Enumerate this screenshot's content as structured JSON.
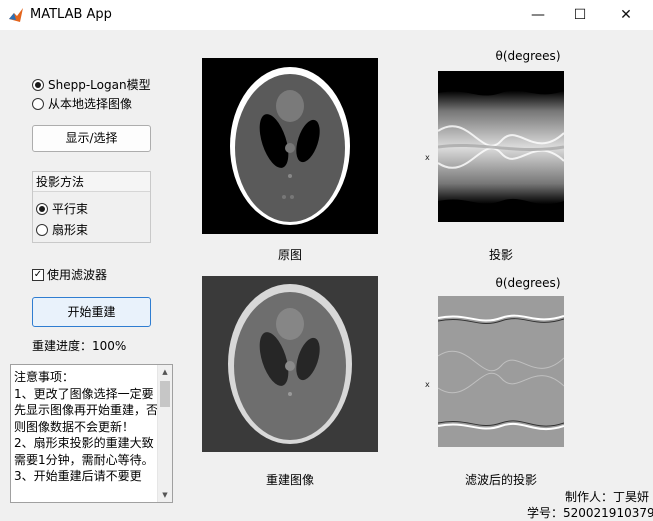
{
  "window": {
    "title": "MATLAB App",
    "minimize": "—",
    "maximize": "☐",
    "close": "✕"
  },
  "source": {
    "option1": "Shepp-Logan模型",
    "option2": "从本地选择图像",
    "selected": "Shepp-Logan模型",
    "show_button": "显示/选择"
  },
  "projection": {
    "title": "投影方法",
    "option1": "平行束",
    "option2": "扇形束",
    "selected": "平行束"
  },
  "filter": {
    "label": "使用滤波器",
    "checked": true
  },
  "reconstruct": {
    "button": "开始重建",
    "progress_label": "重建进度：100%"
  },
  "notes": {
    "text": "注意事项：\n1、更改了图像选择一定要先显示图像再开始重建，否则图像数据不会更新！\n2、扇形束投影的重建大致需要1分钟，需耐心等待。\n3、开始重建后请不要更"
  },
  "axes": {
    "original_caption": "原图",
    "sinogram_caption": "投影",
    "sinogram_title": "θ(degrees)",
    "sinogram_ylabel": "x",
    "recon_caption": "重建图像",
    "filtered_caption": "滤波后的投影",
    "filtered_title": "θ(degrees)",
    "filtered_ylabel": "x"
  },
  "credits": {
    "author": "制作人：丁昊妍",
    "student_id": "学号：520021910379"
  }
}
